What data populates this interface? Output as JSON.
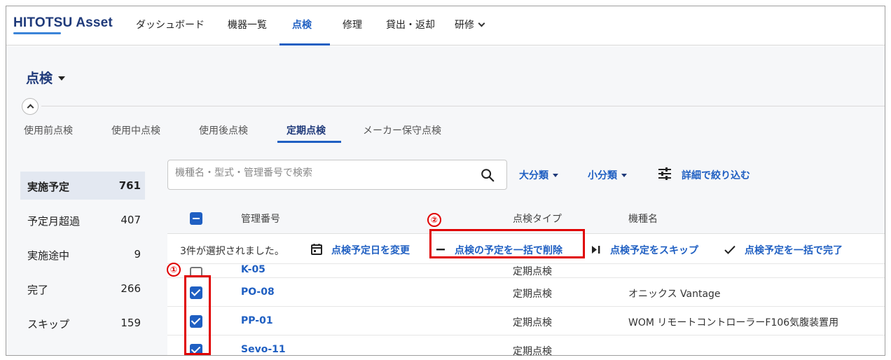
{
  "app": {
    "logo_text": "HITOTSU Asset"
  },
  "nav": {
    "items": [
      "ダッシュボード",
      "機器一覧",
      "点検",
      "修理",
      "貸出・返却",
      "研修"
    ],
    "active": "点検"
  },
  "page": {
    "title": "点検"
  },
  "tabs": [
    "使用前点検",
    "使用中点検",
    "使用後点検",
    "定期点検",
    "メーカー保守点検"
  ],
  "active_tab": "定期点検",
  "summary": [
    {
      "label": "実施予定",
      "count": "761"
    },
    {
      "label": "予定月超過",
      "count": "407"
    },
    {
      "label": "実施途中",
      "count": "9"
    },
    {
      "label": "完了",
      "count": "266"
    },
    {
      "label": "スキップ",
      "count": "159"
    }
  ],
  "search": {
    "placeholder": "機種名・型式・管理番号で検索"
  },
  "filters": {
    "major": "大分類",
    "minor": "小分類",
    "advanced": "詳細で絞り込む"
  },
  "table": {
    "headers": [
      "管理番号",
      "点検タイプ",
      "機種名"
    ],
    "selection_text": "3件が選択されました。",
    "actions": {
      "change_date": "点検予定日を変更",
      "bulk_delete": "点検の予定を一括で削除",
      "skip": "点検予定をスキップ",
      "bulk_complete": "点検予定を一括で完了"
    },
    "partial_row": {
      "id": "K-05",
      "type": "定期点検"
    },
    "rows": [
      {
        "id": "PO-08",
        "type": "定期点検",
        "model": "オニックス Vantage",
        "checked": true
      },
      {
        "id": "PP-01",
        "type": "定期点検",
        "model": "WOM リモートコントローラーF106気腹装置用",
        "checked": true
      },
      {
        "id": "Sevo-11",
        "type": "定期点検",
        "model": "",
        "checked": true
      }
    ]
  },
  "annotations": {
    "one": "①",
    "two": "②"
  },
  "colors": {
    "accent": "#1f5fc2",
    "brand": "#1f3a7a",
    "annotation": "#e00000"
  }
}
